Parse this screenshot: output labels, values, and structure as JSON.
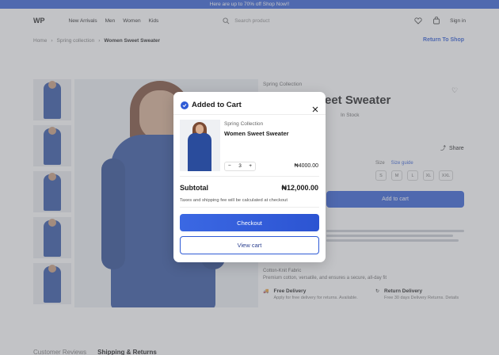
{
  "promo": "Here are up to 70% off Shop Now!!",
  "header": {
    "logo": "WP",
    "nav": [
      "New Arrivals",
      "Men",
      "Women",
      "Kids"
    ],
    "search_placeholder": "Search product",
    "signin": "Sign in"
  },
  "breadcrumb": [
    "Home",
    "Spring collection",
    "Women Sweet Sweater"
  ],
  "return_label": "Return To Shop",
  "product": {
    "collection": "Spring Collection",
    "title_fragment": "eet Sweater",
    "in_stock": "In Stock",
    "share": "Share",
    "size_label": "Size",
    "size_guide": "Size guide",
    "sizes": [
      "S",
      "M",
      "L",
      "XL",
      "XXL"
    ],
    "add_to_cart": "Add to cart",
    "fabric_title": "Cotton-Knit Fabric",
    "fabric_line": "Premium cotton, versatile, and ensures a secure, all-day fit",
    "free_delivery_title": "Free Delivery",
    "free_delivery_text": "Apply for free delivery for returns. Available.",
    "return_delivery_title": "Return Delivery",
    "return_delivery_text": "Free 30 days Delivery Returns. Details"
  },
  "tabs": [
    "Customer Reviews",
    "Shipping & Returns"
  ],
  "modal": {
    "title": "Added to Cart",
    "item": {
      "collection": "Spring Collection",
      "name": "Women Sweet Sweater",
      "quantity": "3",
      "minus": "−",
      "plus": "+",
      "price": "₦4000.00"
    },
    "subtotal_label": "Subtotal",
    "subtotal_value": "₦12,000.00",
    "note": "Taxes and shipping fee will be calculated at checkout",
    "checkout_label": "Checkout",
    "view_cart_label": "View cart"
  },
  "colors": {
    "accent": "#2f5bd6",
    "overlay": "#787a80"
  }
}
